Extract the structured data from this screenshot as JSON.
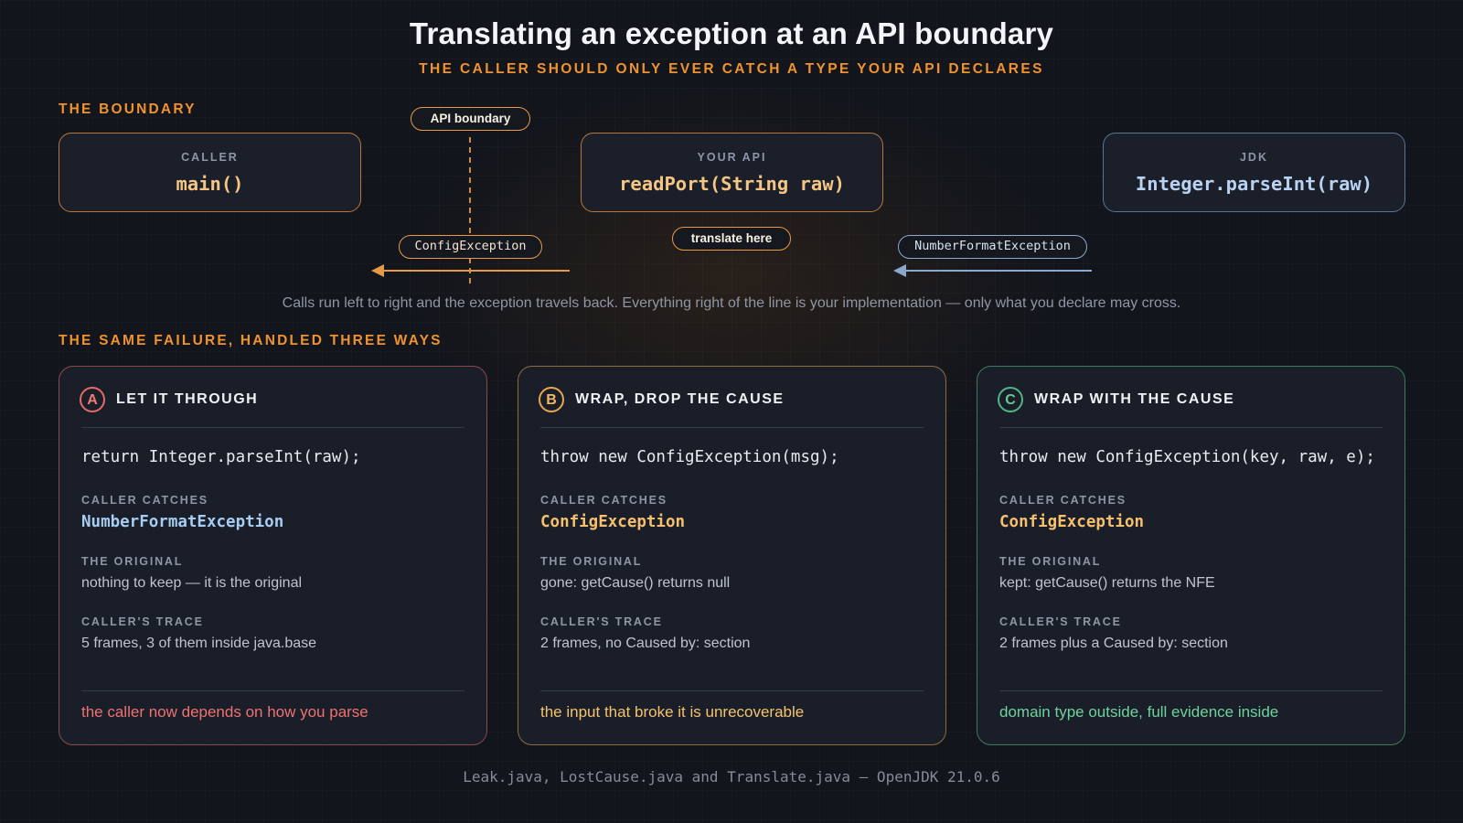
{
  "title": "Translating an exception at an API boundary",
  "subtitle": "THE CALLER SHOULD ONLY EVER CATCH A TYPE YOUR API DECLARES",
  "boundary_section": {
    "label": "THE BOUNDARY",
    "nodes": {
      "caller": {
        "label": "CALLER",
        "code": "main()"
      },
      "api": {
        "label": "YOUR API",
        "code": "readPort(String raw)"
      },
      "jdk": {
        "label": "JDK",
        "code": "Integer.parseInt(raw)"
      }
    },
    "boundary_pill": "API boundary",
    "translate_pill": "translate here",
    "outgoing_exception": "ConfigException",
    "incoming_exception": "NumberFormatException",
    "caption": "Calls run left to right and the exception travels back. Everything right of the line is your implementation — only what you declare may cross.",
    "colors": {
      "accent": "#f0922e",
      "jdk": "#8aa9cc"
    }
  },
  "approaches_section": {
    "label": "THE SAME FAILURE, HANDLED THREE WAYS",
    "cards": [
      {
        "badge": "A",
        "title": "LET IT THROUGH",
        "code": "return Integer.parseInt(raw);",
        "caller_catches_label": "CALLER CATCHES",
        "caller_catches": "NumberFormatException",
        "original_label": "THE ORIGINAL",
        "original": "nothing to keep — it is the original",
        "trace_label": "CALLER'S TRACE",
        "trace": "5 frames, 3 of them inside java.base",
        "verdict": "the caller now depends on how you parse",
        "color": "#e36a6a"
      },
      {
        "badge": "B",
        "title": "WRAP, DROP THE CAUSE",
        "code": "throw new ConfigException(msg);",
        "caller_catches_label": "CALLER CATCHES",
        "caller_catches": "ConfigException",
        "original_label": "THE ORIGINAL",
        "original": "gone: getCause() returns null",
        "trace_label": "CALLER'S TRACE",
        "trace": "2 frames, no Caused by: section",
        "verdict": "the input that broke it is unrecoverable",
        "color": "#e8a64e"
      },
      {
        "badge": "C",
        "title": "WRAP WITH THE CAUSE",
        "code": "throw new ConfigException(key, raw, e);",
        "caller_catches_label": "CALLER CATCHES",
        "caller_catches": "ConfigException",
        "original_label": "THE ORIGINAL",
        "original": "kept: getCause() returns the NFE",
        "trace_label": "CALLER'S TRACE",
        "trace": "2 frames plus a Caused by: section",
        "verdict": "domain type outside, full evidence inside",
        "color": "#4fb584"
      }
    ]
  },
  "footer": "Leak.java, LostCause.java and Translate.java — OpenJDK 21.0.6"
}
